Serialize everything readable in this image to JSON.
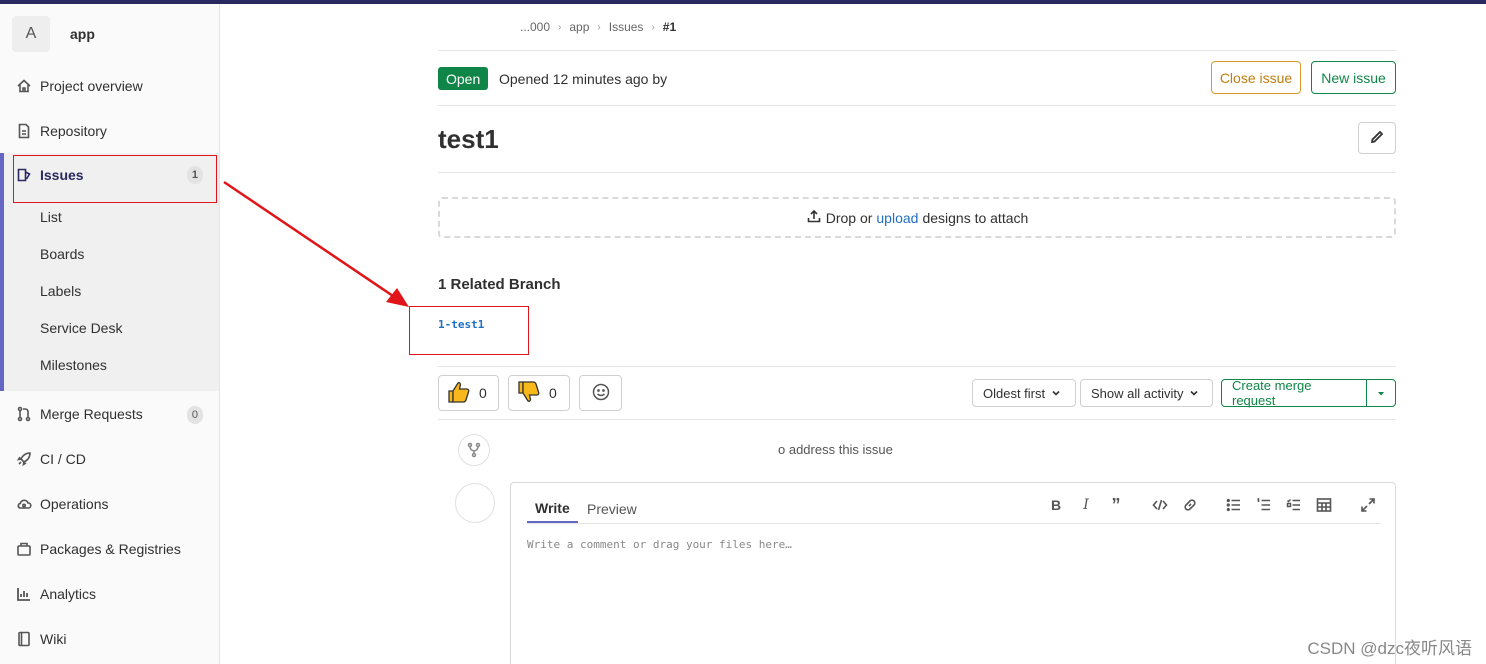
{
  "sidebar": {
    "context_letter": "A",
    "context_name": "app",
    "items": [
      {
        "label": "Project overview",
        "icon": "home-icon"
      },
      {
        "label": "Repository",
        "icon": "document-icon"
      },
      {
        "label": "Issues",
        "icon": "issues-icon",
        "badge": "1"
      },
      {
        "label": "Merge Requests",
        "icon": "merge-request-icon",
        "badge": "0"
      },
      {
        "label": "CI / CD",
        "icon": "rocket-icon"
      },
      {
        "label": "Operations",
        "icon": "cloud-gear-icon"
      },
      {
        "label": "Packages & Registries",
        "icon": "package-icon"
      },
      {
        "label": "Analytics",
        "icon": "chart-icon"
      },
      {
        "label": "Wiki",
        "icon": "book-icon"
      }
    ],
    "issues_sub": [
      "List",
      "Boards",
      "Labels",
      "Service Desk",
      "Milestones"
    ]
  },
  "breadcrumb": {
    "group": "...000",
    "project": "app",
    "section": "Issues",
    "current": "#1"
  },
  "issue": {
    "status": "Open",
    "opened_text": "Opened 12 minutes ago by",
    "close_label": "Close issue",
    "new_label": "New issue",
    "title": "test1"
  },
  "dropzone": {
    "prefix": "Drop or",
    "link": "upload",
    "suffix": "designs to attach"
  },
  "related": {
    "title": "1 Related Branch",
    "branch": "1-test1"
  },
  "reactions": {
    "thumbs_up": "0",
    "thumbs_down": "0"
  },
  "activity": {
    "sort_label": "Oldest first",
    "filter_label": "Show all activity",
    "create_mr_label": "Create merge request",
    "note_text": "o address this issue"
  },
  "editor": {
    "write_tab": "Write",
    "preview_tab": "Preview",
    "placeholder": "Write a comment or drag your files here…"
  },
  "watermark": "CSDN @dzc夜听风语",
  "colors": {
    "accent": "#6666c4",
    "success": "#108548",
    "warning": "#db9a2a",
    "annotation": "#e0151a"
  }
}
